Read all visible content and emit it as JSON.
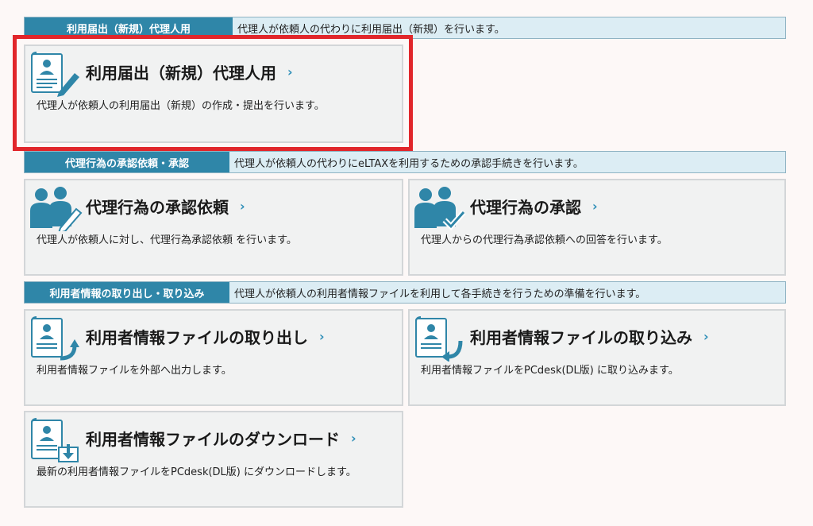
{
  "sections": [
    {
      "tag": "利用届出（新規）代理人用",
      "desc": "代理人が依頼人の代わりに利用届出（新規）を行います。"
    },
    {
      "tag": "代理行為の承認依頼・承認",
      "desc": "代理人が依頼人の代わりにeLTAXを利用するための承認手続きを行います。"
    },
    {
      "tag": "利用者情報の取り出し・取り込み",
      "desc": "代理人が依頼人の利用者情報ファイルを利用して各手続きを行うための準備を行います。"
    }
  ],
  "cards": {
    "registration": {
      "title": "利用届出（新規）代理人用",
      "chevron": "›",
      "desc": "代理人が依頼人の利用届出（新規）の作成・提出を行います。",
      "icon": "document-pen-icon"
    },
    "approval_request": {
      "title": "代理行為の承認依頼",
      "chevron": "›",
      "desc": "代理人が依頼人に対し、代理行為承認依頼 を行います。",
      "icon": "people-pen-icon"
    },
    "approval": {
      "title": "代理行為の承認",
      "chevron": "›",
      "desc": "代理人からの代理行為承認依頼への回答を行います。",
      "icon": "people-check-icon"
    },
    "export": {
      "title": "利用者情報ファイルの取り出し",
      "chevron": "›",
      "desc": "利用者情報ファイルを外部へ出力します。",
      "icon": "document-export-icon"
    },
    "import": {
      "title": "利用者情報ファイルの取り込み",
      "chevron": "›",
      "desc": "利用者情報ファイルをPCdesk(DL版) に取り込みます。",
      "icon": "document-import-icon"
    },
    "download": {
      "title": "利用者情報ファイルのダウンロード",
      "chevron": "›",
      "desc": "最新の利用者情報ファイルをPCdesk(DL版) にダウンロードします。",
      "icon": "document-download-icon"
    }
  },
  "colors": {
    "accent": "#2f86a8",
    "highlight": "#e1262b",
    "card_bg": "#f1f2f2"
  }
}
